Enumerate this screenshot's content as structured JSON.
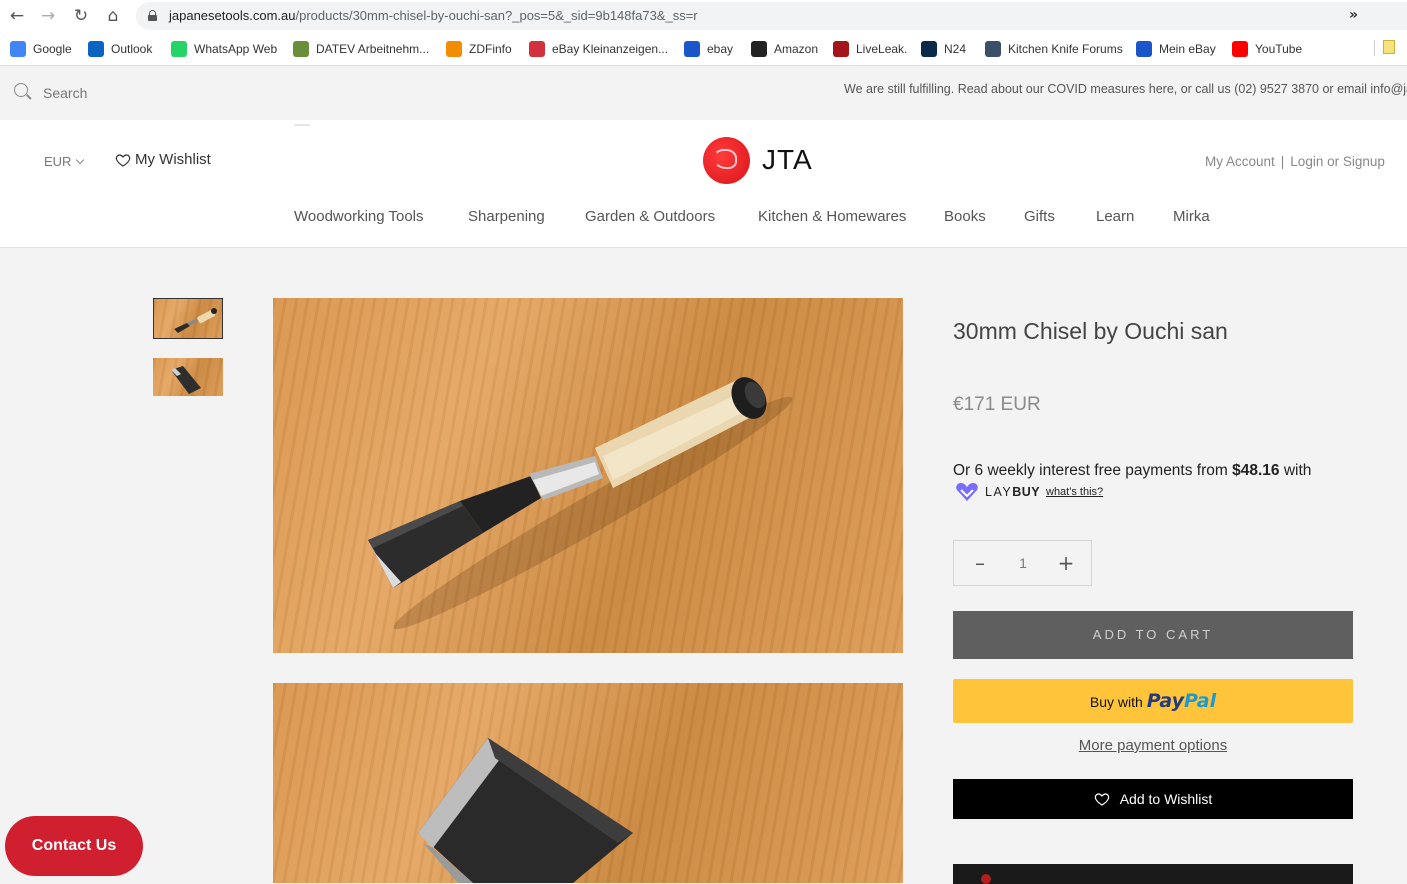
{
  "browser": {
    "url_host": "japanesetools.com.au",
    "url_path": "/products/30mm-chisel-by-ouchi-san?_pos=5&_sid=9b148fa73&_ss=r",
    "bookmarks": [
      {
        "label": "Google",
        "icon": "google-icon",
        "color": "#4285f4"
      },
      {
        "label": "Outlook",
        "icon": "outlook-icon",
        "color": "#0a64c0"
      },
      {
        "label": "WhatsApp Web",
        "icon": "whatsapp-icon",
        "color": "#25d366"
      },
      {
        "label": "DATEV Arbeitnehm...",
        "icon": "datev-icon",
        "color": "#6a8f3a"
      },
      {
        "label": "ZDFinfo",
        "icon": "zdf-icon",
        "color": "#f28c00"
      },
      {
        "label": "eBay Kleinanzeigen...",
        "icon": "kleinanzeigen-icon",
        "color": "#d1313c"
      },
      {
        "label": "ebay",
        "icon": "ebay-bag-icon",
        "color": "#1a56c9"
      },
      {
        "label": "Amazon",
        "icon": "amazon-icon",
        "color": "#222222"
      },
      {
        "label": "LiveLeak.",
        "icon": "liveleak-icon",
        "color": "#a3141b"
      },
      {
        "label": "N24",
        "icon": "n24-icon",
        "color": "#0b2a4a"
      },
      {
        "label": "Kitchen Knife Forums",
        "icon": "kkf-icon",
        "color": "#3b4f6b"
      },
      {
        "label": "Mein eBay",
        "icon": "mein-ebay-icon",
        "color": "#1a56c9"
      },
      {
        "label": "YouTube",
        "icon": "youtube-icon",
        "color": "#ff0000"
      }
    ],
    "more": "»"
  },
  "announce": {
    "search_placeholder": "Search",
    "text": "We are still fulfilling. Read about our COVID measures here, or call us (02) 9527 3870 or email info@japa"
  },
  "header": {
    "currency": "EUR",
    "wishlist": "My Wishlist",
    "logo_text": "JTA",
    "account": "My Account",
    "login": "Login or Signup",
    "nav": [
      "Woodworking Tools",
      "Sharpening",
      "Garden & Outdoors",
      "Kitchen & Homewares",
      "Books",
      "Gifts",
      "Learn",
      "Mirka"
    ]
  },
  "product": {
    "title": "30mm Chisel by Ouchi san",
    "price": "€171 EUR",
    "laybuy_prefix": "Or 6 weekly interest free payments from ",
    "laybuy_amount": "$48.16",
    "laybuy_suffix": " with",
    "laybuy_brand_light": "LAY",
    "laybuy_brand_bold": "BUY",
    "whats_this": "what's this?",
    "quantity": "1",
    "add_to_cart": "ADD TO CART",
    "buy_with": "Buy with",
    "paypal_1": "Pay",
    "paypal_2": "Pal",
    "more_payment": "More payment options",
    "add_wishlist": "Add to Wishlist"
  },
  "contact": "Contact Us",
  "colors": {
    "brand_red": "#d0202f",
    "cart_button": "#5f5f5f",
    "paypal_yellow": "#ffc439",
    "laybuy_purple": "#786dff"
  }
}
